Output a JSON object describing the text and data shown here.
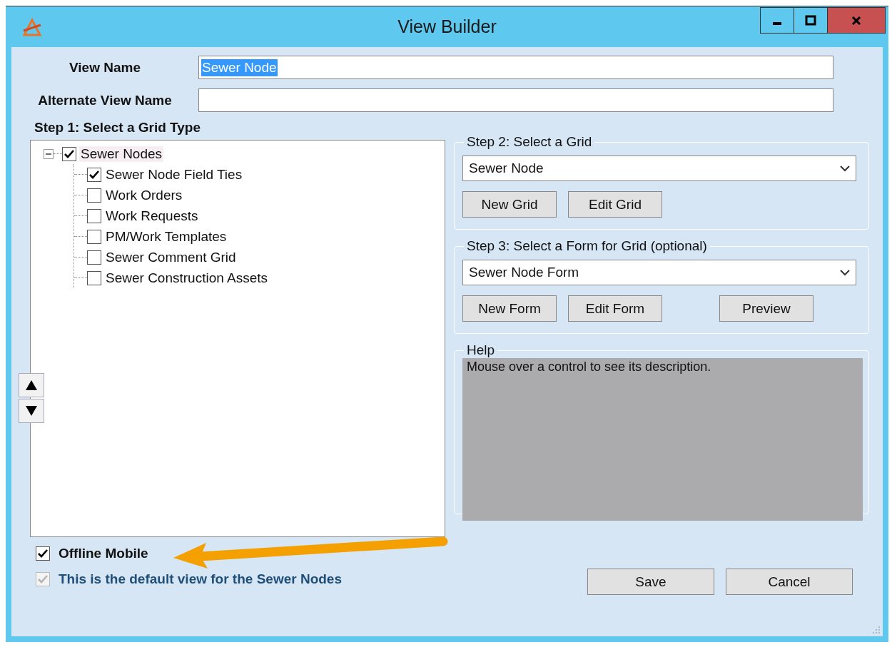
{
  "window": {
    "title": "View Builder"
  },
  "view_name": {
    "label": "View Name",
    "value": "Sewer Node",
    "highlighted": true
  },
  "alternate_view_name": {
    "label": "Alternate View Name"
  },
  "step1": {
    "label": "Step 1: Select a Grid Type",
    "tree": [
      {
        "label": "Sewer Nodes",
        "checked": true,
        "expanded": true,
        "selected": true,
        "children": [
          {
            "label": "Sewer Node Field Ties",
            "checked": true,
            "selected": false
          },
          {
            "label": "Work Orders",
            "checked": false,
            "selected": false
          },
          {
            "label": "Work Requests",
            "checked": false,
            "selected": false
          },
          {
            "label": "PM/Work Templates",
            "checked": false,
            "selected": false
          },
          {
            "label": "Sewer Comment Grid",
            "checked": false,
            "selected": false
          },
          {
            "label": "Sewer Construction Assets",
            "checked": false,
            "selected": false
          }
        ]
      }
    ]
  },
  "step2": {
    "label": "Step 2: Select a Grid",
    "dropdown": "Sewer Node",
    "buttons": [
      "New Grid",
      "Edit Grid"
    ]
  },
  "step3": {
    "label": "Step 3: Select a Form for Grid (optional)",
    "dropdown": "Sewer Node Form",
    "buttons": [
      "New Form",
      "Edit Form",
      "Preview"
    ]
  },
  "help": {
    "label": "Help",
    "text": "Mouse over a control to see its description."
  },
  "options": [
    {
      "label": "Offline Mobile",
      "checked": true,
      "disabled": false
    },
    {
      "label": "This is the default view for the Sewer Nodes",
      "checked": true,
      "disabled": true
    }
  ],
  "buttons": [
    "Save",
    "Cancel"
  ]
}
